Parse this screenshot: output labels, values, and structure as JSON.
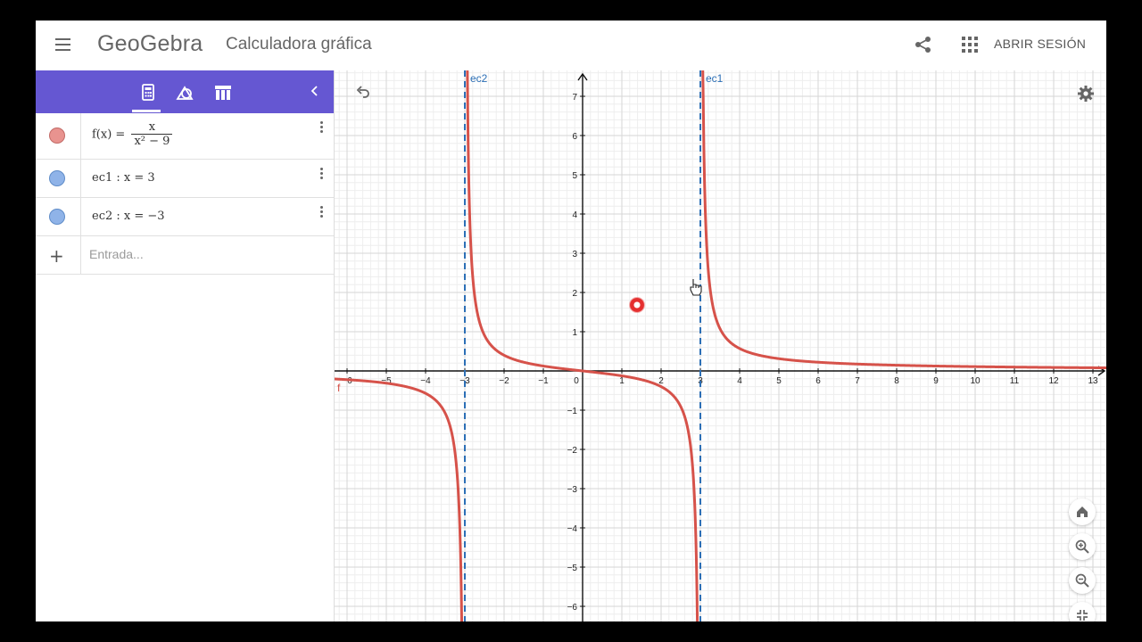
{
  "header": {
    "logo": "GeoGebra",
    "title": "Calculadora gráfica",
    "signin_label": "ABRIR SESIÓN"
  },
  "algebra": {
    "items": [
      {
        "lhs": "f(x) =",
        "num": "x",
        "den": "x² − 9",
        "color": "#e8938f"
      },
      {
        "text": "ec1 : x = 3",
        "color": "#8fb3e8"
      },
      {
        "text": "ec2 : x = −3",
        "color": "#8fb3e8"
      }
    ],
    "input_placeholder": "Entrada...",
    "plus_symbol": "+"
  },
  "graph": {
    "x_ticks": [
      "−6",
      "−5",
      "−4",
      "−3",
      "−2",
      "−1",
      "0",
      "1",
      "2",
      "3",
      "4",
      "5",
      "6",
      "7",
      "8",
      "9",
      "10",
      "11",
      "12",
      "13"
    ],
    "y_ticks": [
      "7",
      "6",
      "5",
      "4",
      "3",
      "2",
      "1",
      "−1",
      "−2",
      "−3",
      "−4",
      "−5",
      "−6"
    ],
    "labels": {
      "ec1": "ec1",
      "ec2": "ec2",
      "f": "f"
    },
    "function_color": "#d6524a",
    "line_color": "#2c6fb6",
    "toolbar_color": "#6557d2"
  }
}
